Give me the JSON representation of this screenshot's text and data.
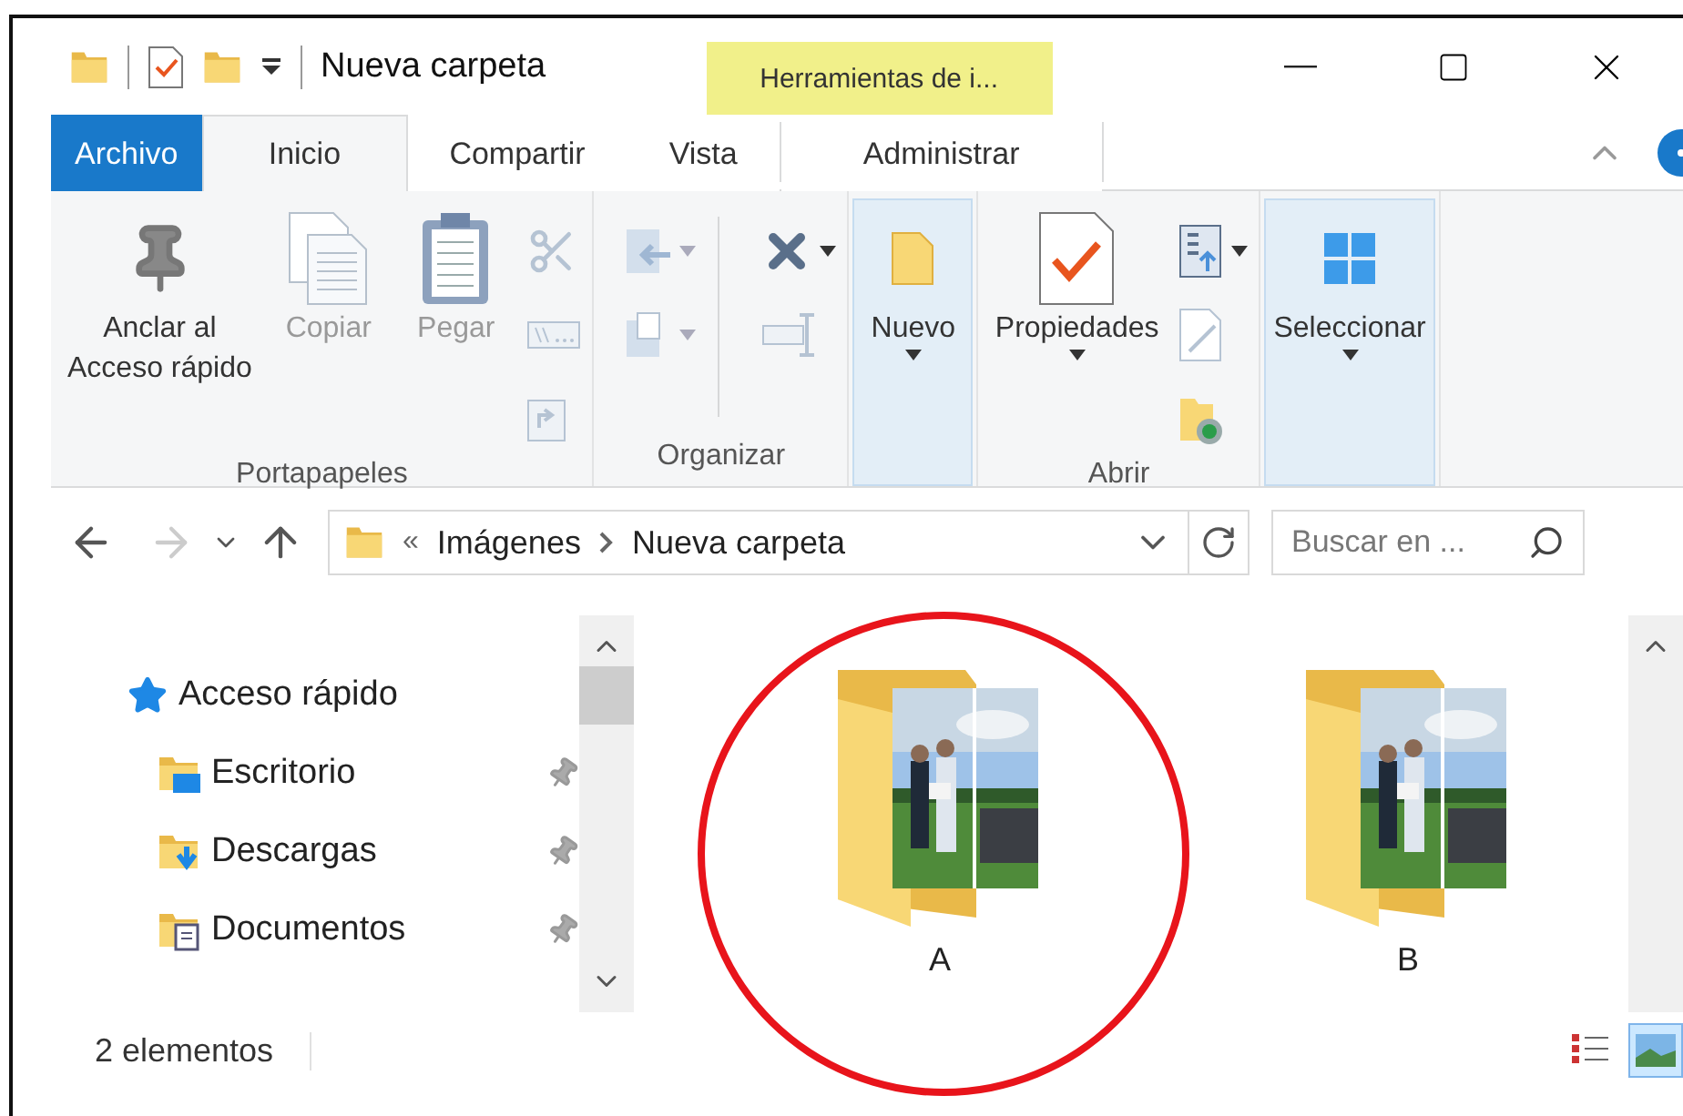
{
  "title_bar": {
    "title": "Nueva carpeta",
    "contextual_tab": "Herramientas de i..."
  },
  "ribbon_tabs": [
    {
      "label": "Archivo",
      "kind": "file",
      "selected": false
    },
    {
      "label": "Inicio",
      "kind": "tab",
      "selected": true
    },
    {
      "label": "Compartir",
      "kind": "tab",
      "selected": false
    },
    {
      "label": "Vista",
      "kind": "tab",
      "selected": false
    },
    {
      "label": "Administrar",
      "kind": "contextual",
      "selected": false
    }
  ],
  "ribbon_groups": [
    {
      "label": "Portapapeles",
      "large": [
        {
          "kind": "pin",
          "label": "Anclar al\nAcceso rápido",
          "disabled": false,
          "dropdown": false,
          "highlighted": false
        },
        {
          "kind": "copy",
          "label": "Copiar",
          "disabled": true,
          "dropdown": false,
          "highlighted": false
        },
        {
          "kind": "paste",
          "label": "Pegar",
          "disabled": true,
          "dropdown": false,
          "highlighted": false
        }
      ],
      "columns": [
        [
          {
            "kind": "cut",
            "disabled": true,
            "dropdown": false
          },
          {
            "kind": "copy-path",
            "disabled": true,
            "dropdown": false
          },
          {
            "kind": "paste-shortcut",
            "disabled": true,
            "dropdown": false
          }
        ]
      ]
    },
    {
      "label": "Organizar",
      "columns": [
        [
          {
            "kind": "move-to",
            "disabled": true,
            "dropdown": true
          },
          {
            "kind": "copy-to",
            "disabled": true,
            "dropdown": true
          }
        ],
        [
          {
            "kind": "delete",
            "disabled": false,
            "dropdown": true
          },
          {
            "kind": "rename",
            "disabled": true,
            "dropdown": false
          }
        ]
      ]
    },
    {
      "large": [
        {
          "kind": "new",
          "label": "Nuevo",
          "disabled": false,
          "dropdown": true,
          "highlighted": true
        }
      ]
    },
    {
      "label": "Abrir",
      "large": [
        {
          "kind": "properties",
          "label": "Propiedades",
          "disabled": false,
          "dropdown": true,
          "highlighted": false
        }
      ],
      "columns": [
        [
          {
            "kind": "open",
            "disabled": false,
            "dropdown": true
          },
          {
            "kind": "edit",
            "disabled": true,
            "dropdown": false
          },
          {
            "kind": "history",
            "disabled": false,
            "dropdown": false
          }
        ]
      ]
    },
    {
      "large": [
        {
          "kind": "select",
          "label": "Seleccionar",
          "disabled": false,
          "dropdown": true,
          "highlighted": true
        }
      ]
    }
  ],
  "navigation": {
    "back": {
      "disabled": false
    },
    "forward": {
      "disabled": true
    }
  },
  "address": {
    "overflow_mark": "«",
    "path": [
      "Imágenes",
      "Nueva carpeta"
    ]
  },
  "search": {
    "placeholder": "Buscar en ..."
  },
  "sidebar": {
    "items": [
      {
        "kind": "star",
        "label": "Acceso rápido",
        "children": [
          {
            "kind": "desktop",
            "label": "Escritorio",
            "pinned": true
          },
          {
            "kind": "downloads",
            "label": "Descargas",
            "pinned": true
          },
          {
            "kind": "documents",
            "label": "Documentos",
            "pinned": true
          }
        ]
      }
    ]
  },
  "files": [
    {
      "name": "A",
      "circled": true
    },
    {
      "name": "B",
      "circled": false
    }
  ],
  "status_bar": {
    "count": "2 elementos"
  },
  "view_modes": [
    {
      "kind": "details",
      "selected": false
    },
    {
      "kind": "large-icons",
      "selected": true
    }
  ]
}
